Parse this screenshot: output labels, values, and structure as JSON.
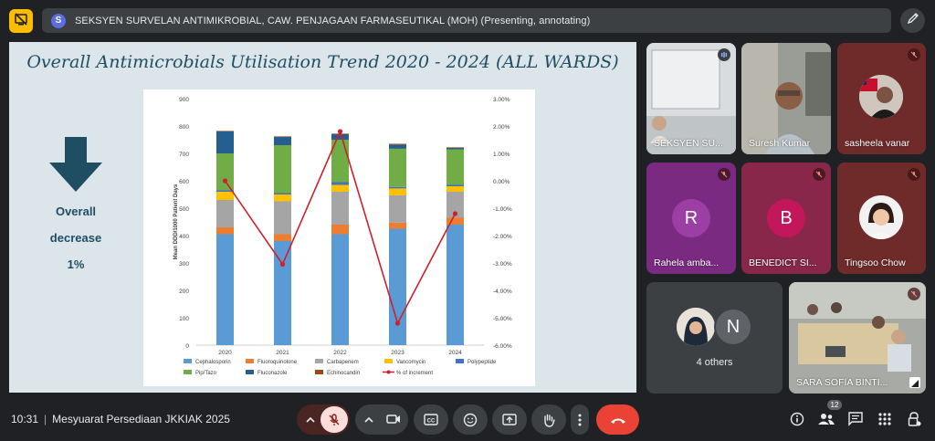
{
  "presenter_bar": {
    "avatar_letter": "S",
    "text": "SEKSYEN SURVELAN ANTIMIKROBIAL, CAW. PENJAGAAN FARMASEUTIKAL (MOH) (Presenting, annotating)"
  },
  "slide": {
    "title": "Overall Antimicrobials Utilisation Trend 2020 - 2024 (ALL WARDS)",
    "side_text_line1": "Overall",
    "side_text_line2": "decrease",
    "side_text_line3": "1%"
  },
  "chart_data": {
    "type": "bar",
    "stacked": true,
    "categories": [
      "2020",
      "2021",
      "2022",
      "2023",
      "2024"
    ],
    "ylabel": "Mean DDD/1000 Patient Days",
    "ylim": [
      0,
      900
    ],
    "yticks": [
      "0",
      "100",
      "200",
      "300",
      "400",
      "500",
      "600",
      "700",
      "800",
      "900"
    ],
    "y2lim": [
      -6,
      3
    ],
    "y2ticks": [
      "-6.00%",
      "-5.00%",
      "-4.00%",
      "-3.00%",
      "-2.00%",
      "-1.00%",
      "0.00%",
      "1.00%",
      "2.00%",
      "3.00%"
    ],
    "series": [
      {
        "name": "Cephalosporin",
        "color": "#5b9bd5",
        "values": [
          405,
          380,
          405,
          425,
          440
        ]
      },
      {
        "name": "Fluoroquinolone",
        "color": "#ed7d31",
        "values": [
          25,
          25,
          35,
          22,
          25
        ]
      },
      {
        "name": "Carbapenem",
        "color": "#a5a5a5",
        "values": [
          100,
          120,
          120,
          100,
          95
        ]
      },
      {
        "name": "Vancomycin",
        "color": "#ffc000",
        "values": [
          30,
          25,
          25,
          25,
          20
        ]
      },
      {
        "name": "Polypeptide",
        "color": "#4472c4",
        "values": [
          5,
          5,
          10,
          5,
          5
        ]
      },
      {
        "name": "Pip/Tazo",
        "color": "#70ad47",
        "values": [
          135,
          175,
          155,
          140,
          130
        ]
      },
      {
        "name": "Fluconazole",
        "color": "#255e91",
        "values": [
          80,
          30,
          20,
          15,
          5
        ]
      },
      {
        "name": "Echinocandin",
        "color": "#9e480e",
        "values": [
          2,
          2,
          2,
          3,
          2
        ]
      }
    ],
    "line_series": {
      "name": "% of increment",
      "color": "#d0202a",
      "values": [
        0.0,
        -3.05,
        1.8,
        -5.2,
        -1.2
      ]
    },
    "legend_position": "bottom"
  },
  "participants": [
    {
      "name": "SEKSYEN SU...",
      "type": "video",
      "status": "speaking"
    },
    {
      "name": "Suresh Kumar",
      "type": "video",
      "status": "none"
    },
    {
      "name": "sasheela vanar",
      "type": "photo",
      "status": "muted",
      "bg": "#6e2b2a"
    },
    {
      "name": "Rahela amba...",
      "type": "letter",
      "letter": "R",
      "status": "muted",
      "bg": "#7a2a80",
      "avatar_bg": "#9c3fa5"
    },
    {
      "name": "BENEDICT SI...",
      "type": "letter",
      "letter": "B",
      "status": "muted",
      "bg": "#88274a",
      "avatar_bg": "#c2185b"
    },
    {
      "name": "Tingsoo Chow",
      "type": "photo",
      "status": "muted",
      "bg": "#6e2b2a"
    },
    {
      "name": "4 others",
      "type": "group",
      "letter": "N",
      "status": "none"
    },
    {
      "name": "SARA SOFIA BINTI...",
      "type": "video",
      "status": "muted"
    }
  ],
  "bottom_bar": {
    "time": "10:31",
    "meeting_title": "Mesyuarat Persediaan JKKIAK 2025",
    "participant_count": "12"
  },
  "colors": {
    "background": "#202124",
    "accent_yellow": "#fbbc04",
    "end_call_red": "#ea4335",
    "mic_off_pink": "#f9dedc"
  },
  "icons": [
    "stop-presenting-icon",
    "pen-icon",
    "mic-off-icon",
    "camera-icon",
    "captions-icon",
    "emoji-icon",
    "present-icon",
    "raise-hand-icon",
    "more-icon",
    "end-call-icon",
    "info-icon",
    "people-icon",
    "chat-icon",
    "activities-icon",
    "host-controls-icon"
  ]
}
